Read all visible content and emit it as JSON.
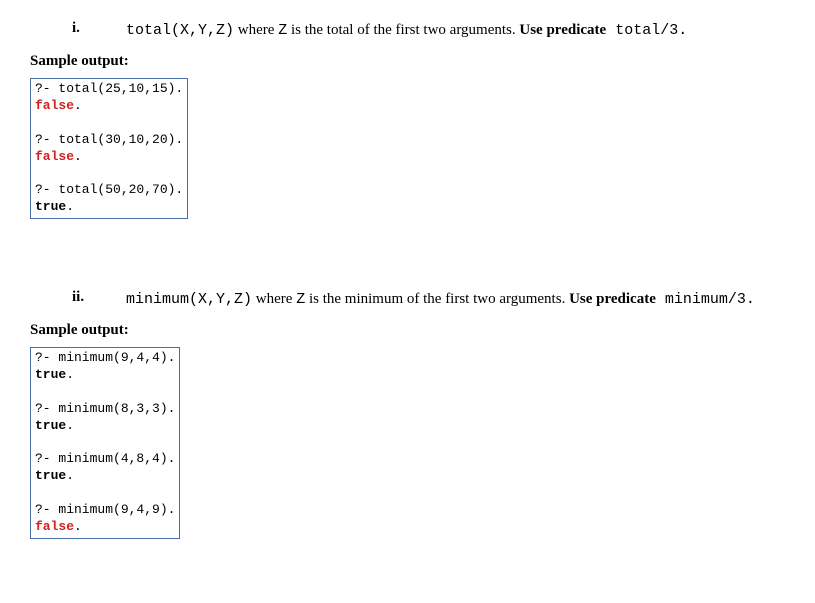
{
  "items": [
    {
      "num": "i.",
      "pred": "total(X,Y,Z)",
      "before_var": " where ",
      "var": "Z",
      "after_var": " is the total of the first two arguments. ",
      "use_label": "Use predicate",
      "pred_sig": " total/3.",
      "sample_label": "Sample output:",
      "queries": [
        {
          "q": "?- total(25,10,15).",
          "r": "false",
          "rclass": "false"
        },
        {
          "q": "?- total(30,10,20).",
          "r": "false",
          "rclass": "false"
        },
        {
          "q": "?- total(50,20,70).",
          "r": "true",
          "rclass": "true"
        }
      ]
    },
    {
      "num": "ii.",
      "pred": "minimum(X,Y,Z)",
      "before_var": " where ",
      "var": "Z",
      "after_var": " is the minimum of the first two arguments. ",
      "use_label": "Use predicate",
      "pred_sig": " minimum/3.",
      "sample_label": "Sample output:",
      "queries": [
        {
          "q": "?- minimum(9,4,4).",
          "r": "true",
          "rclass": "true"
        },
        {
          "q": "?- minimum(8,3,3).",
          "r": "true",
          "rclass": "true"
        },
        {
          "q": "?- minimum(4,8,4).",
          "r": "true",
          "rclass": "true"
        },
        {
          "q": "?- minimum(9,4,9).",
          "r": "false",
          "rclass": "false"
        }
      ]
    }
  ]
}
